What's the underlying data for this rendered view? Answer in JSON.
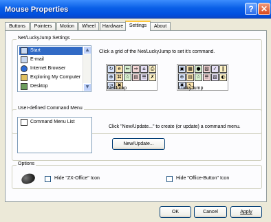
{
  "window": {
    "title": "Mouse Properties",
    "help_label": "?",
    "close_label": "✕"
  },
  "tabs": [
    {
      "label": "Buttons",
      "active": false
    },
    {
      "label": "Pointers",
      "active": false
    },
    {
      "label": "Motion",
      "active": false
    },
    {
      "label": "Wheel",
      "active": false
    },
    {
      "label": "Hardware",
      "active": false
    },
    {
      "label": "Settings",
      "active": true
    },
    {
      "label": "About",
      "active": false
    }
  ],
  "netjump": {
    "group_title": "Net/LuckyJump Settings",
    "instruction": "Click a grid of the Net/LuckyJump to set it's command.",
    "items": [
      {
        "label": "Start",
        "selected": true
      },
      {
        "label": "E-mail",
        "selected": false
      },
      {
        "label": "Internet Browser",
        "selected": false
      },
      {
        "label": "Exploring My Computer",
        "selected": false
      },
      {
        "label": "Desktop",
        "selected": false
      }
    ],
    "netjump_label": "NetJump",
    "luckyjump_label": "LuckyJump",
    "netjump_icons": [
      "↻",
      "e",
      "⇐",
      "⇒",
      "⌂",
      "⎙",
      "⊕",
      "⌘",
      "☆",
      "▤",
      "☰",
      "✗",
      "→",
      "✖"
    ],
    "luckyjump_icons": [
      "▣",
      "▦",
      "●",
      "▧",
      "✓",
      "‖",
      "⊕",
      "▤",
      "☆",
      "☰",
      "▧",
      "◐",
      "✖",
      "↖"
    ]
  },
  "commands": {
    "group_title": "User-defined Command Menu",
    "list_item": "Command Menu List",
    "instruction": "Click \"New/Update...\" to create (or update) a command menu.",
    "new_update_label": "New/Update..."
  },
  "options": {
    "group_title": "Options",
    "hide_zx_office": "Hide \"ZX-Office\" Icon",
    "hide_office_button": "Hide \"Office-Button\" Icon",
    "hide_zx_office_checked": false,
    "hide_office_button_checked": false
  },
  "footer": {
    "ok_label": "OK",
    "cancel_label": "Cancel",
    "apply_label": "Apply"
  }
}
